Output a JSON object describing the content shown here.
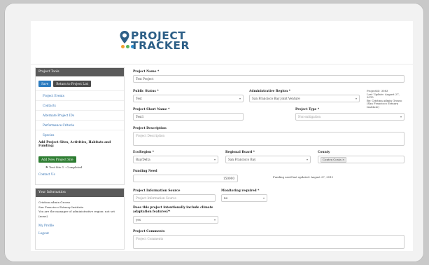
{
  "brand": {
    "line1": "PROJECT",
    "line2": "TRACKER",
    "pin_color": "#2d5f87",
    "dot_colors": [
      "#f0a030",
      "#5ab55a",
      "#2d8fd0"
    ]
  },
  "sidebar": {
    "tools_title": "Project Tools",
    "save_label": "Save",
    "return_label": "Return to Project List",
    "items": [
      {
        "label": "Project Events"
      },
      {
        "label": "Contacts"
      },
      {
        "label": "Alternate Project IDs"
      },
      {
        "label": "Performance Criteria"
      },
      {
        "label": "Species"
      }
    ],
    "add_sites_heading": "Add Project Sites, Activities, Habitats and Funding:",
    "add_site_button": "Add New Project Site",
    "site_entry": "Test Site 1 - Completed",
    "contact_us": "Contact Us"
  },
  "info_panel": {
    "title": "Your Information",
    "user_name": "Cristina admin Grosso",
    "org": "San Francisco Estuary Institute",
    "manager_note": "You are the manager of administrative region: not set (none)",
    "profile_link": "My Profile",
    "logout_link": "Logout"
  },
  "form": {
    "project_name_label": "Project Name *",
    "project_name_value": "Test Project",
    "public_status_label": "Public Status *",
    "public_status_value": "Test",
    "admin_region_label": "Administrative Region *",
    "admin_region_value": "San Francisco Bay Joint Venture",
    "project_meta_1": "ProjectID: 3083",
    "project_meta_2": "Last Update: August 27, 2015",
    "project_meta_3": "By: Cristina admin Grosso (San Francisco Estuary Institute)",
    "short_name_label": "Project Short Name *",
    "short_name_value": "Test1",
    "project_type_label": "Project Type *",
    "project_type_value": "Non-mitigation",
    "description_label": "Project Description",
    "description_placeholder": "Project Description",
    "ecoregion_label": "EcoRegion *",
    "ecoregion_value": "Bay/Delta",
    "regional_board_label": "Regional Board *",
    "regional_board_value": "San Francisco Bay",
    "county_label": "County",
    "county_tag": "Contra Costa ×",
    "funding_need_label": "Funding Need",
    "funding_need_value": "150000",
    "funding_updated_note": "Funding need last updated: August 27, 2015",
    "info_source_label": "Project Information Source",
    "info_source_placeholder": "Project Information Source",
    "monitoring_label": "Monitoring required *",
    "monitoring_value": "no",
    "climate_label_1": "Does this project intentionally include climate",
    "climate_label_2": "adaptation features?*",
    "climate_value": "yes",
    "comments_label": "Project Comments",
    "comments_placeholder": "Project Comments"
  }
}
